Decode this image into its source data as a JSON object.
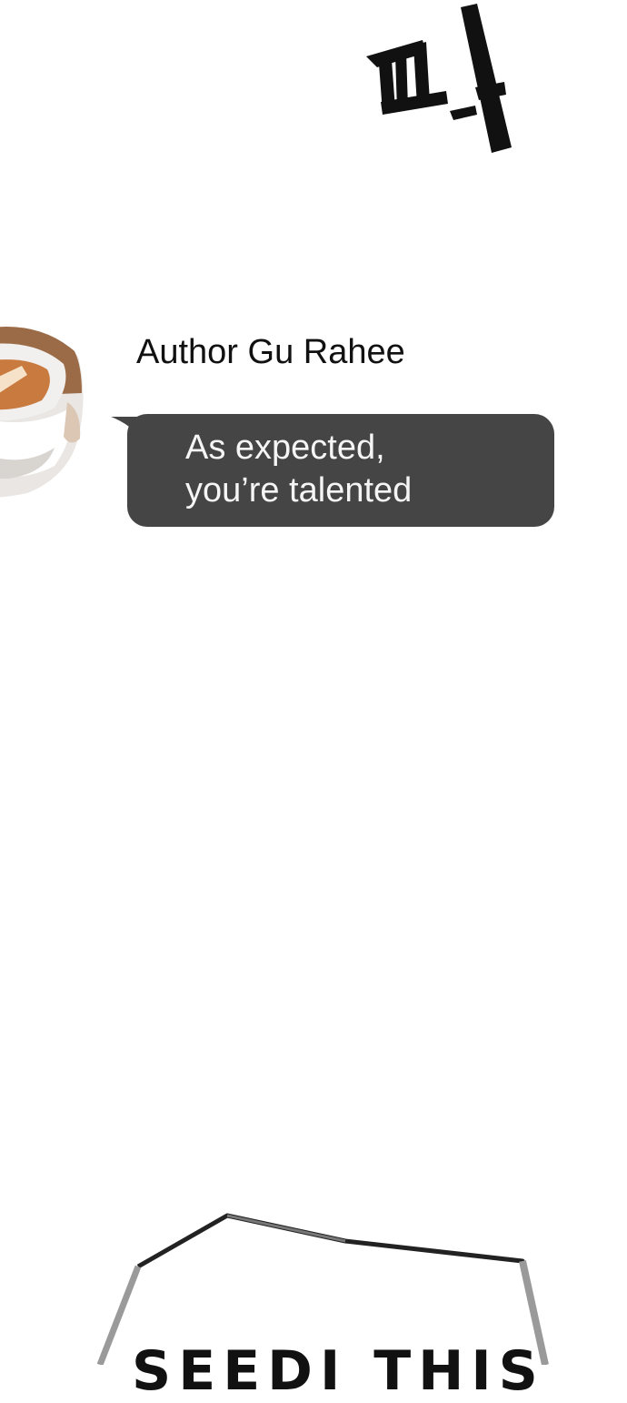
{
  "sound_effect": {
    "text": "띡"
  },
  "message": {
    "author": "Author Gu Rahee",
    "lines": [
      "As expected,",
      "you’re talented"
    ]
  },
  "bottom_panel": {
    "partial_text": "SEEDI THIS"
  },
  "colors": {
    "background": "#ffffff",
    "bubble": "#454545",
    "bubble_text": "#f5f5f5",
    "name_text": "#111111"
  }
}
